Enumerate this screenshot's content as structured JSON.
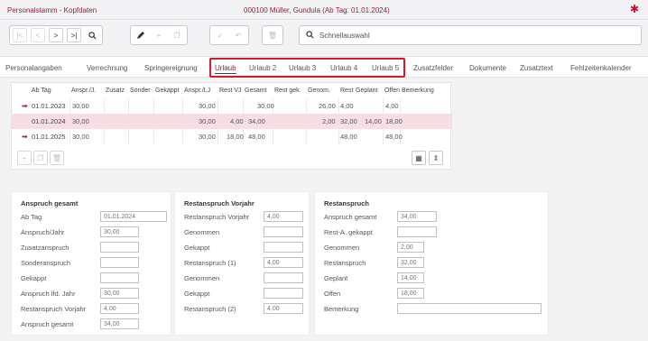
{
  "titlebar": {
    "app": "Personalstamm - Kopfdaten",
    "record": "000100  Müller, Gundula  (Ab Tag: 01.01.2024)",
    "pin_icon": "pin-icon"
  },
  "toolbar": {
    "search_placeholder": "Schnellauswahl"
  },
  "tabs": [
    "Personalangaben",
    "Verrechnung",
    "Springereignung",
    "Urlaub",
    "Urlaub 2",
    "Urlaub 3",
    "Urlaub 4",
    "Urlaub 5",
    "Zusatzfelder",
    "Dokumente",
    "Zusatztext",
    "Fehlzeitenkalender"
  ],
  "active_tab": "Urlaub",
  "grid": {
    "columns": [
      "Ab Tag",
      "Anspr./J.",
      "Zusatz",
      "Sonder",
      "Gekappt",
      "Anspr./LJ",
      "Rest VJ",
      "Gesamt",
      "Rest gek.",
      "Genom.",
      "Rest",
      "Geplant",
      "Offen",
      "Bemerkung"
    ],
    "rows": [
      {
        "ab_tag": "01.01.2023",
        "anspr_j": "30,00",
        "zusatz": "",
        "sonder": "",
        "gekappt": "",
        "anspr_lj": "30,00",
        "rest_vj": "",
        "gesamt": "30,00",
        "rest_gek": "",
        "genom": "26,00",
        "rest": "4,00",
        "geplant": "",
        "offen": "4,00",
        "bemerkung": "",
        "marker": true,
        "selected": false
      },
      {
        "ab_tag": "01.01.2024",
        "anspr_j": "30,00",
        "zusatz": "",
        "sonder": "",
        "gekappt": "",
        "anspr_lj": "30,00",
        "rest_vj": "4,00",
        "gesamt": "34,00",
        "rest_gek": "",
        "genom": "2,00",
        "rest": "32,00",
        "geplant": "14,00",
        "offen": "18,00",
        "bemerkung": "",
        "marker": false,
        "selected": true
      },
      {
        "ab_tag": "01.01.2025",
        "anspr_j": "30,00",
        "zusatz": "",
        "sonder": "",
        "gekappt": "",
        "anspr_lj": "30,00",
        "rest_vj": "18,00",
        "gesamt": "48,00",
        "rest_gek": "",
        "genom": "",
        "rest": "48,00",
        "geplant": "",
        "offen": "48,00",
        "bemerkung": "",
        "marker": true,
        "selected": false
      }
    ]
  },
  "anspruch_gesamt": {
    "title": "Anspruch gesamt",
    "fields": [
      {
        "label": "Ab Tag",
        "value": "01.01.2024"
      },
      {
        "label": "Anspruch/Jahr",
        "value": "30,00"
      },
      {
        "label": "Zusatzanspruch",
        "value": ""
      },
      {
        "label": "Sonderanspruch",
        "value": ""
      },
      {
        "label": "Gekappt",
        "value": ""
      },
      {
        "label": "Anspruch lfd. Jahr",
        "value": "30,00"
      },
      {
        "label": "Restanspruch Vorjahr",
        "value": "4,00"
      },
      {
        "label": "Anspruch gesamt",
        "value": "34,00"
      }
    ]
  },
  "restanspruch_vorjahr": {
    "title": "Restanspruch Vorjahr",
    "fields": [
      {
        "label": "Restanspruch Vorjahr",
        "value": "4,00"
      },
      {
        "label": "Genommen",
        "value": ""
      },
      {
        "label": "Gekappt",
        "value": ""
      },
      {
        "label": "Restanspruch (1)",
        "value": "4,00"
      },
      {
        "label": "Genommen",
        "value": ""
      },
      {
        "label": "Gekappt",
        "value": ""
      },
      {
        "label": "Restanspruch (2)",
        "value": "4,00"
      }
    ]
  },
  "restanspruch": {
    "title": "Restanspruch",
    "fields": [
      {
        "label": "Anspruch gesamt",
        "value": "34,00"
      },
      {
        "label": "Rest-A. gekappt",
        "value": ""
      },
      {
        "label": "Genommen",
        "value": "2,00"
      },
      {
        "label": "Restanspruch",
        "value": "32,00"
      },
      {
        "label": "Geplant",
        "value": "14,00"
      },
      {
        "label": "Offen",
        "value": "18,00"
      },
      {
        "label": "Bemerkung",
        "value": ""
      }
    ]
  },
  "colors": {
    "accent": "#8a2443",
    "highlight": "#d7192f",
    "selected_row": "#f7dde4"
  }
}
